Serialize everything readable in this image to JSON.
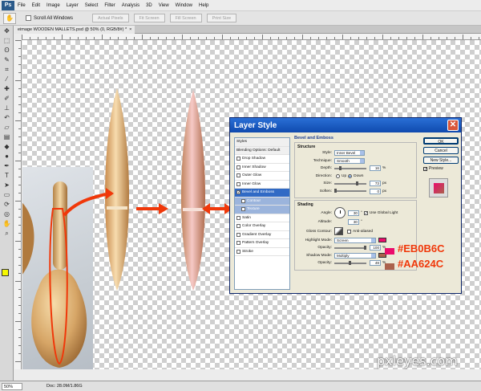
{
  "app": {
    "logo": "Ps"
  },
  "menu": [
    "File",
    "Edit",
    "Image",
    "Layer",
    "Select",
    "Filter",
    "Analysis",
    "3D",
    "View",
    "Window",
    "Help"
  ],
  "options": {
    "scroll_all_windows": "Scroll All Windows",
    "buttons": [
      "Actual Pixels",
      "Fit Screen",
      "Fill Screen",
      "Print Size"
    ]
  },
  "document": {
    "tab_title": "eimage WOODEN MALLETS.psd @ 50% (0, RGB/8#) *",
    "close_glyph": "×"
  },
  "status": {
    "zoom": "50%",
    "doc_info": "Doc: 28.0M/1.86G"
  },
  "dialog": {
    "title": "Layer Style",
    "close_glyph": "✕",
    "styles_header": "Styles",
    "blending_options": "Blending Options: Default",
    "effects": [
      {
        "label": "Drop Shadow",
        "checked": false
      },
      {
        "label": "Inner Shadow",
        "checked": false
      },
      {
        "label": "Outer Glow",
        "checked": false
      },
      {
        "label": "Inner Glow",
        "checked": false
      },
      {
        "label": "Bevel and Emboss",
        "checked": true,
        "selected": true
      },
      {
        "label": "Contour",
        "checked": false,
        "sub": true
      },
      {
        "label": "Texture",
        "checked": false,
        "sub": true
      },
      {
        "label": "Satin",
        "checked": false
      },
      {
        "label": "Color Overlay",
        "checked": false
      },
      {
        "label": "Gradient Overlay",
        "checked": false
      },
      {
        "label": "Pattern Overlay",
        "checked": false
      },
      {
        "label": "Stroke",
        "checked": false
      }
    ],
    "panel_title": "Bevel and Emboss",
    "structure": {
      "title": "Structure",
      "style_label": "Style:",
      "style_value": "Inner Bevel",
      "technique_label": "Technique:",
      "technique_value": "Smooth",
      "depth_label": "Depth:",
      "depth_value": "16",
      "depth_level": 0.16,
      "direction_label": "Direction:",
      "up": "Up",
      "down": "Down",
      "direction_value": "Down",
      "size_label": "Size:",
      "size_value": "73",
      "size_level": 0.73,
      "soften_label": "Soften:",
      "soften_value": "0",
      "soften_level": 0,
      "unit_pct": "%",
      "unit_px": "px"
    },
    "shading": {
      "title": "Shading",
      "angle_label": "Angle:",
      "angle_value": "30",
      "global_light": "Use Global Light",
      "altitude_label": "Altitude:",
      "altitude_value": "30",
      "gloss_label": "Gloss Contour:",
      "anti_aliased": "Anti-aliased",
      "highlight_label": "Highlight Mode:",
      "highlight_value": "Screen",
      "h_opacity_label": "Opacity:",
      "h_opacity_value": "100",
      "h_opacity_level": 1.0,
      "shadow_label": "Shadow Mode:",
      "shadow_value": "Multiply",
      "s_opacity_label": "Opacity:",
      "s_opacity_value": "49",
      "s_opacity_level": 0.49,
      "highlight_color": "#EB0B6C",
      "shadow_color": "#AA624C",
      "unit_pct": "%",
      "degree": "°"
    },
    "buttons": {
      "ok": "OK",
      "cancel": "Cancel",
      "new_style": "New Style...",
      "preview": "Preview"
    }
  },
  "annotations": {
    "highlight_hex": "#EB0B6C",
    "shadow_hex": "#AA624C",
    "accent": "#f0380a"
  },
  "watermark": "pxleyes.com"
}
